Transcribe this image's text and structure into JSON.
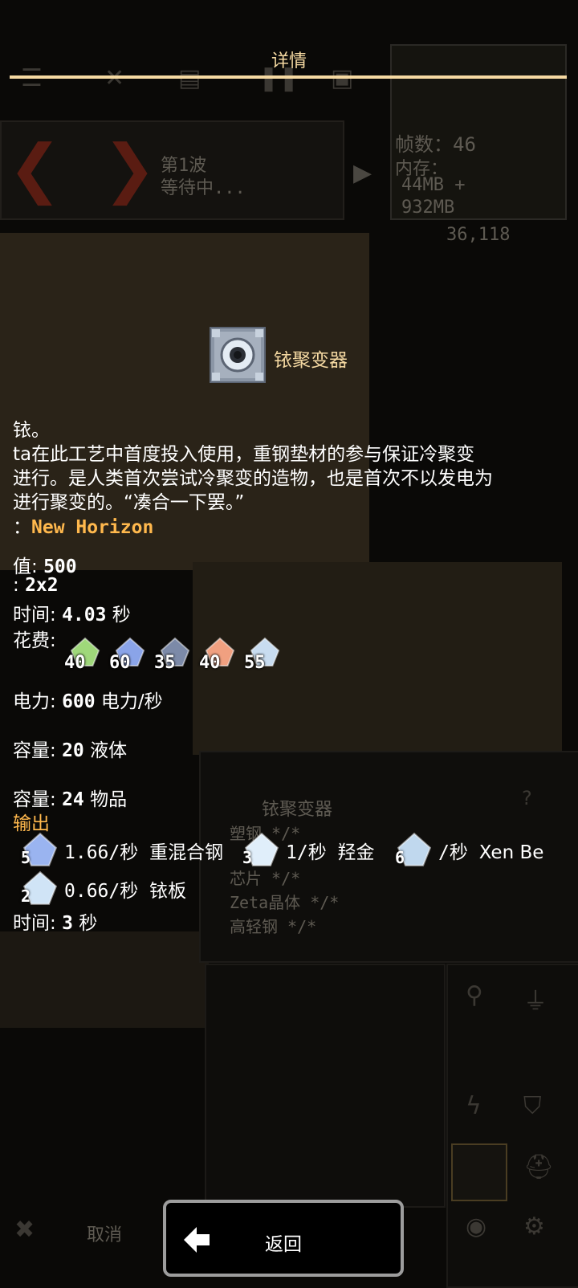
{
  "dialog": {
    "title": "详情",
    "back_label": "返回"
  },
  "block": {
    "name": "铱聚变器",
    "description_lines": [
      "铱。",
      "ta在此工艺中首度投入使用，重钢垫材的参与保证冷聚变",
      "进行。是人类首次尝试冷聚变的造物，也是首次不以发电为",
      "进行聚变的。“凑合一下罢。”"
    ],
    "mod_prefix": "：",
    "mod_name": "New Horizon"
  },
  "stats": {
    "build_value": {
      "label": "值:",
      "value": "500"
    },
    "size": {
      "label": ":",
      "value": "2x2"
    },
    "build_time": {
      "label": "时间:",
      "value": "4.03",
      "unit": "秒"
    },
    "build_cost_label": "花费:",
    "build_cost": [
      {
        "amount": "40",
        "icon": "item-green-crystal-icon",
        "color": "#9fd87a"
      },
      {
        "amount": "60",
        "icon": "item-blue-crystal-icon",
        "color": "#8aa4e8"
      },
      {
        "amount": "35",
        "icon": "item-dark-alloy-icon",
        "color": "#7c8aa8"
      },
      {
        "amount": "40",
        "icon": "item-orange-crystal-icon",
        "color": "#f0a080"
      },
      {
        "amount": "55",
        "icon": "item-ice-crystal-icon",
        "color": "#c8dcf0"
      }
    ],
    "power": {
      "label": "电力:",
      "value": "600",
      "unit": "电力/秒"
    },
    "liquid_capacity": {
      "label": "容量:",
      "value": "20",
      "unit": "液体"
    },
    "item_capacity": {
      "label": "容量:",
      "value": "24",
      "unit": "物品"
    },
    "output_label": "输出",
    "outputs_row1": [
      {
        "count": "5",
        "rate": "1.66/秒",
        "name": "重混合钢",
        "icon": "multi-steel-icon",
        "color": "#9ab4f0"
      },
      {
        "count": "3",
        "rate": "1/秒",
        "name": "羟金",
        "icon": "ice-crystal-icon",
        "color": "#e0eefa"
      },
      {
        "count": "6",
        "rate": "/秒",
        "name": "Xen Be",
        "icon": "liquid-drop-icon",
        "color": "#c0d8ee"
      }
    ],
    "outputs_row2": [
      {
        "count": "2",
        "rate": "0.66/秒",
        "name": "铱板",
        "icon": "iridium-plate-icon",
        "color": "#d0e4f6"
      }
    ],
    "craft_time": {
      "label": "时间:",
      "value": "3",
      "unit": "秒"
    }
  },
  "background": {
    "wave_label": "第1波",
    "wave_status": "等待中...",
    "fps_label": "帧数：46",
    "memory_label": "内存：",
    "memory_used": "44MB +",
    "memory_total": "932MB",
    "coords": "36,118",
    "panel_block_name": "铱聚变器",
    "panel_lines": [
      "塑钢 */*",
      "芯片 */*",
      "Zeta晶体 */*",
      "高轻钢 */*"
    ],
    "cancel_label": "取消"
  }
}
